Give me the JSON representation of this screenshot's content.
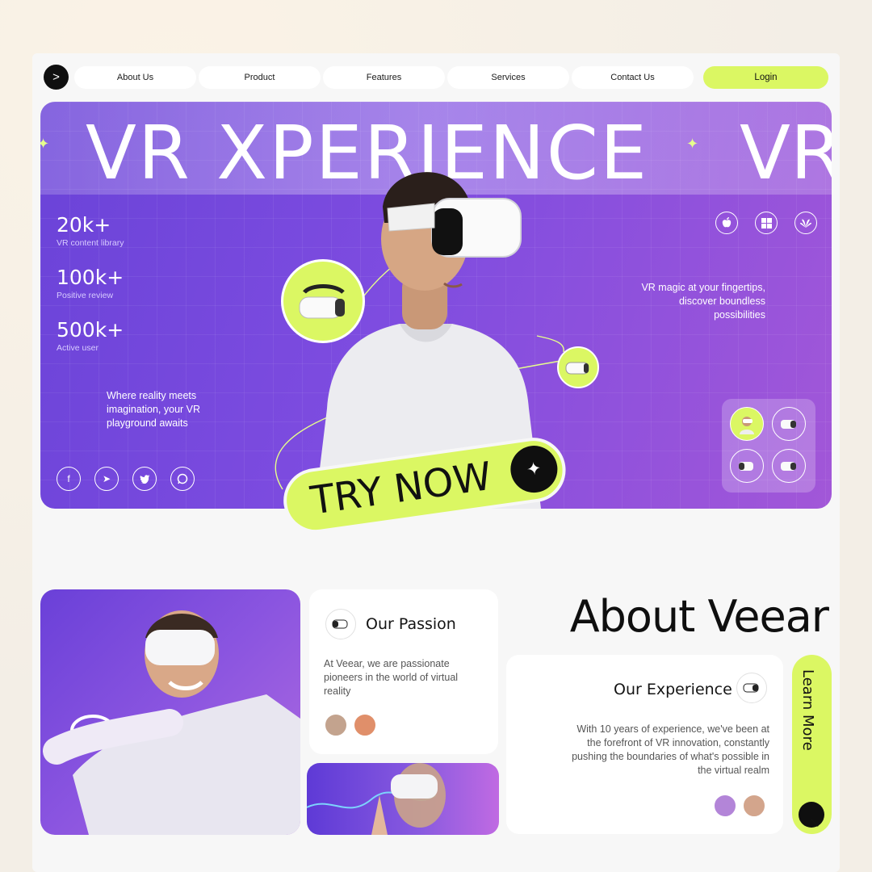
{
  "nav": {
    "logo_glyph": ">",
    "items": [
      "About Us",
      "Product",
      "Features",
      "Services",
      "Contact Us"
    ],
    "login": "Login"
  },
  "hero": {
    "title": "VR XPERIENCE",
    "title_repeat": "VR",
    "stats": [
      {
        "value": "20k+",
        "label": "VR content library"
      },
      {
        "value": "100k+",
        "label": "Positive review"
      },
      {
        "value": "500k+",
        "label": "Active user"
      }
    ],
    "tagline_left": "Where reality meets imagination, your VR playground awaits",
    "tagline_right": "VR magic at your fingertips, discover boundless possibilities",
    "cta": "TRY NOW",
    "cta_icon": "✦",
    "social_icons": [
      "facebook-icon",
      "telegram-icon",
      "twitter-icon",
      "whatsapp-icon"
    ],
    "platform_icons": [
      "apple-icon",
      "windows-icon",
      "huawei-icon"
    ]
  },
  "about": {
    "title": "About Veear",
    "passion": {
      "title": "Our Passion",
      "text": "At Veear, we are passionate pioneers in the world of virtual reality"
    },
    "experience": {
      "title": "Our Experience",
      "text": "With 10 years of experience, we've been at the forefront of VR innovation, constantly pushing the boundaries of what's possible in the virtual realm"
    },
    "learn_more": "Learn More",
    "learn_icon": "↗"
  },
  "colors": {
    "accent": "#dbf763",
    "hero_purple": "#7e4ce0",
    "dark": "#0f0f0f"
  }
}
